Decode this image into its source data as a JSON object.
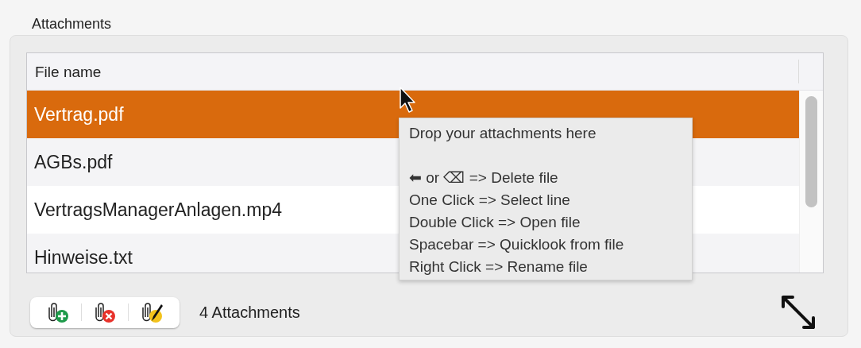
{
  "group": {
    "title": "Attachments"
  },
  "table": {
    "columns": [
      "File name"
    ],
    "rows": [
      {
        "name": "Vertrag.pdf",
        "selected": true
      },
      {
        "name": "AGBs.pdf",
        "selected": false
      },
      {
        "name": "VertragsManagerAnlagen.mp4",
        "selected": false
      },
      {
        "name": "Hinweise.txt",
        "selected": false
      }
    ]
  },
  "tooltip": {
    "title": "Drop your attachments here",
    "lines": [
      "⬅ or ⌫  => Delete file",
      "One Click  => Select line",
      "Double Click  => Open file",
      "Spacebar  => Quicklook from file",
      "Right Click  => Rename file"
    ]
  },
  "toolbar": {
    "buttons": [
      {
        "kind": "add"
      },
      {
        "kind": "remove"
      },
      {
        "kind": "edit"
      }
    ]
  },
  "status": "4 Attachments"
}
